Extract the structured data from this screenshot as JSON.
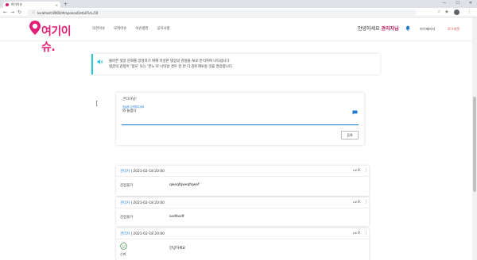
{
  "browser": {
    "tab_title": "여기이슈",
    "tab_close": "×",
    "new_tab": "+",
    "url": "localhost:8000/#/opinionDetail?id=50"
  },
  "header": {
    "logo_text": "여기이슈.",
    "nav": [
      "의견이슈",
      "모여이슈",
      "이슈랭킹",
      "공지사항"
    ],
    "greeting_prefix": "안녕하세요",
    "greeting_name": "관리자님",
    "mypage": "마이페이지",
    "logout": "로그아웃"
  },
  "notice": {
    "line1": "올바른 댓글 문화를 양성하기 위해 작성한 댓글의 감정을 AI로 분석하여 나타냅니다.",
    "line2": "댓글의 감정이 '협오' 또는 '분노'로 나타날 경우 한 번 더 검토해보실 것을 권장합니다."
  },
  "comment_form": {
    "user": "관리자님!",
    "hint": "댓글을 입력해주세요",
    "value": "와 놀랍다",
    "submit": "등록"
  },
  "comments": [
    {
      "name": "관리자",
      "date": " | 2021-02-18 20:00",
      "likes": "0",
      "dots": "⋮",
      "emotion": "감정불가",
      "body": "qweqfqweqfqwef"
    },
    {
      "name": "관리자",
      "date": " | 2021-02-18 20:00",
      "likes": "0",
      "dots": "⋮",
      "emotion": "감정불가",
      "body": "asdfasdf"
    },
    {
      "name": "관리자",
      "date": " | 2021-02-18 20:00",
      "likes": "0",
      "dots": "⋮",
      "emotion": "신뢰",
      "body": "안녕하세요"
    }
  ],
  "colors": {
    "brand": "#e11d74",
    "accent": "#1976d2",
    "notice_border": "#26c6da",
    "logout": "#e53935"
  }
}
